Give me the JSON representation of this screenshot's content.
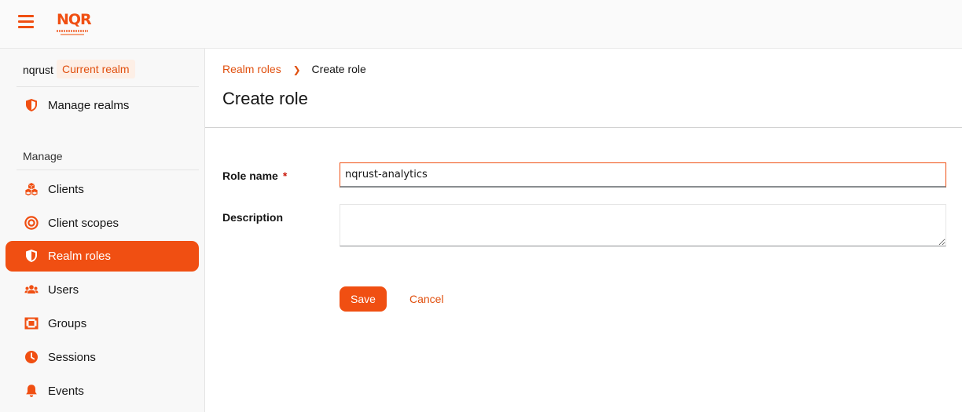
{
  "header": {
    "menu_icon": "hamburger-menu-icon",
    "logo_text": "NQR"
  },
  "sidebar": {
    "realm_name": "nqrust",
    "realm_badge": "Current realm",
    "manage_realms": {
      "label": "Manage realms",
      "icon": "shield-icon"
    },
    "section_label": "Manage",
    "items": [
      {
        "label": "Clients",
        "icon": "cubes-icon",
        "active": false
      },
      {
        "label": "Client scopes",
        "icon": "target-icon",
        "active": false
      },
      {
        "label": "Realm roles",
        "icon": "shield-icon",
        "active": true
      },
      {
        "label": "Users",
        "icon": "users-icon",
        "active": false
      },
      {
        "label": "Groups",
        "icon": "groups-icon",
        "active": false
      },
      {
        "label": "Sessions",
        "icon": "clock-icon",
        "active": false
      },
      {
        "label": "Events",
        "icon": "bell-icon",
        "active": false
      }
    ]
  },
  "breadcrumb": {
    "parent": "Realm roles",
    "current": "Create role"
  },
  "page_title": "Create role",
  "form": {
    "role_name_label": "Role name",
    "required_mark": "*",
    "role_name_value": "nqrust-analytics",
    "description_label": "Description",
    "description_value": ""
  },
  "actions": {
    "save_label": "Save",
    "cancel_label": "Cancel"
  },
  "colors": {
    "accent": "#f04f12",
    "badge_bg": "#fdefe6"
  }
}
